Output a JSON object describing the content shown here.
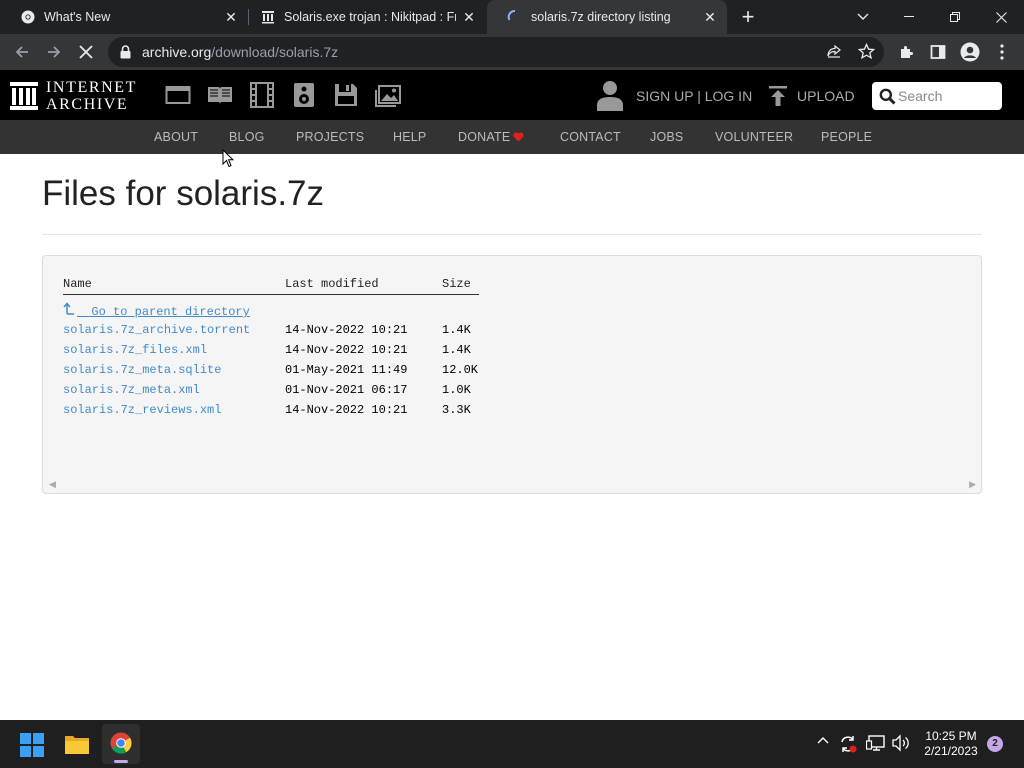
{
  "browser": {
    "tabs": [
      {
        "title": "What's New",
        "active": false
      },
      {
        "title": "Solaris.exe trojan : Nikitpad : Fre",
        "active": false
      },
      {
        "title": "solaris.7z directory listing",
        "active": true
      }
    ],
    "url_host": "archive.org",
    "url_path": "/download/solaris.7z"
  },
  "site": {
    "logo_line1": "INTERNET",
    "logo_line2": "ARCHIVE",
    "signup_label": "SIGN UP | LOG IN",
    "upload_label": "UPLOAD",
    "search_placeholder": "Search",
    "nav": [
      "ABOUT",
      "BLOG",
      "PROJECTS",
      "HELP",
      "DONATE",
      "CONTACT",
      "JOBS",
      "VOLUNTEER",
      "PEOPLE"
    ]
  },
  "page": {
    "title": "Files for solaris.7z",
    "columns": {
      "name": "Name",
      "modified": "Last modified",
      "size": "Size"
    },
    "parent_label": "Go to parent directory",
    "files": [
      {
        "name": "solaris.7z_archive.torrent",
        "modified": "14-Nov-2022 10:21",
        "size": "1.4K"
      },
      {
        "name": "solaris.7z_files.xml",
        "modified": "14-Nov-2022 10:21",
        "size": "1.4K"
      },
      {
        "name": "solaris.7z_meta.sqlite",
        "modified": "01-May-2021 11:49",
        "size": "12.0K"
      },
      {
        "name": "solaris.7z_meta.xml",
        "modified": "01-Nov-2021 06:17",
        "size": "1.0K"
      },
      {
        "name": "solaris.7z_reviews.xml",
        "modified": "14-Nov-2022 10:21",
        "size": "3.3K"
      }
    ]
  },
  "taskbar": {
    "time": "10:25 PM",
    "date": "2/21/2023",
    "notification_count": "2"
  },
  "colors": {
    "link": "#428bca",
    "donate_heart": "#e0201a",
    "taskbar_active_indicator": "#c3a7e6"
  }
}
